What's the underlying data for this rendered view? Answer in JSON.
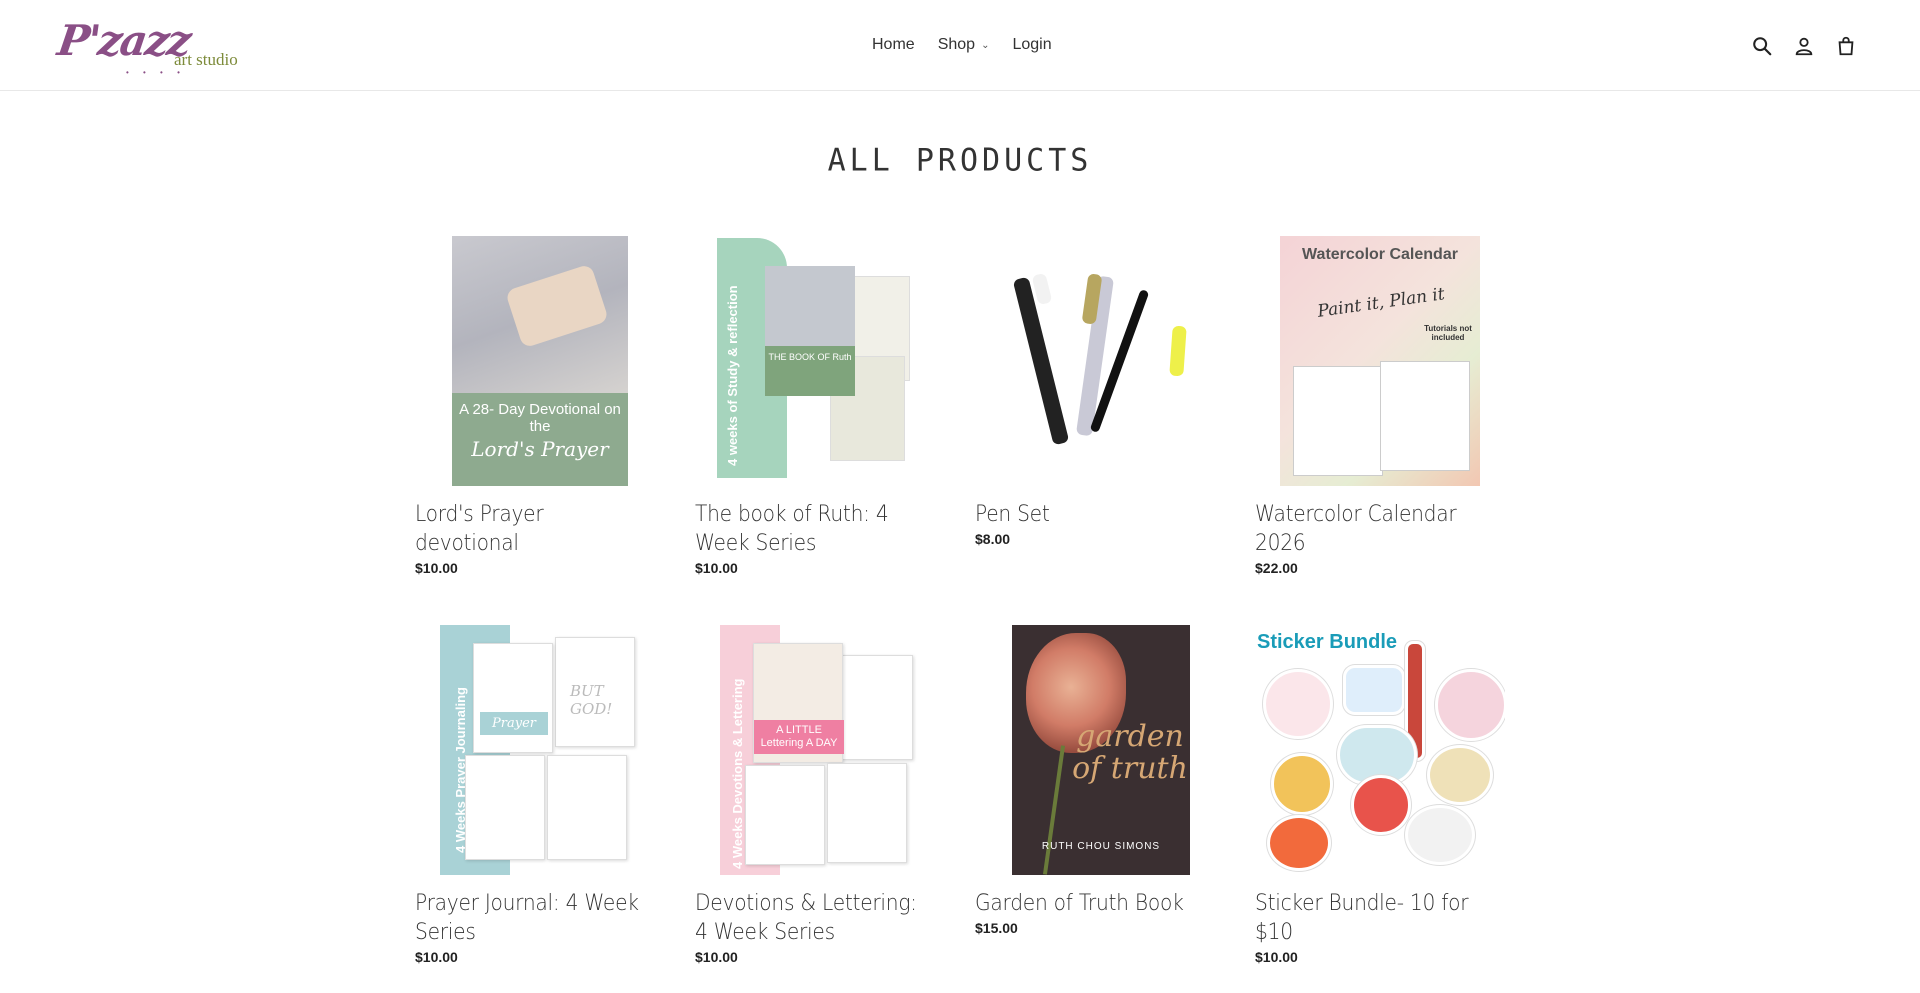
{
  "header": {
    "logo": {
      "script_text": "P'zazz",
      "sub_text": "art studio"
    },
    "nav": [
      {
        "label": "Home"
      },
      {
        "label": "Shop",
        "has_dropdown": true
      },
      {
        "label": "Login"
      }
    ],
    "icons": [
      "search-icon",
      "account-icon",
      "cart-icon"
    ]
  },
  "page_title": "ALL PRODUCTS",
  "products": [
    {
      "name": "Lord's Prayer devotional",
      "price": "$10.00",
      "thumb_text": [
        "A 28- Day Devotional on the",
        "Lord's Prayer"
      ]
    },
    {
      "name": "The book of Ruth: 4 Week Series",
      "price": "$10.00",
      "thumb_text": [
        "4 weeks of Study & reflection",
        "THE BOOK OF Ruth"
      ]
    },
    {
      "name": "Pen Set",
      "price": "$8.00",
      "thumb_text": []
    },
    {
      "name": "Watercolor Calendar 2026",
      "price": "$22.00",
      "thumb_text": [
        "Watercolor Calendar",
        "Paint it, Plan it",
        "Tutorials not included"
      ]
    },
    {
      "name": "Prayer Journal: 4 Week Series",
      "price": "$10.00",
      "thumb_text": [
        "4 Weeks Prayer Journaling",
        "Prayer",
        "BUT GOD!"
      ]
    },
    {
      "name": "Devotions & Lettering: 4 Week Series",
      "price": "$10.00",
      "thumb_text": [
        "4 Weeks Devotions & Lettering",
        "A LITTLE Lettering A DAY"
      ]
    },
    {
      "name": "Garden of Truth Book",
      "price": "$15.00",
      "thumb_text": [
        "garden of truth",
        "RUTH CHOU SIMONS"
      ]
    },
    {
      "name": "Sticker Bundle- 10 for $10",
      "price": "$10.00",
      "thumb_text": [
        "Sticker Bundle"
      ]
    }
  ],
  "colors": {
    "brand_purple": "#8a4f86",
    "brand_olive": "#7d8b3a",
    "sticker_blue": "#1a9cb8"
  }
}
